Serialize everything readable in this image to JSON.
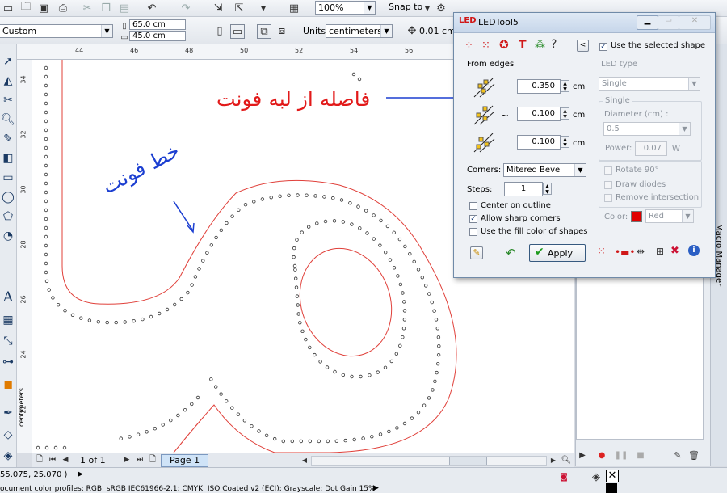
{
  "toolbar": {
    "zoom_value": "100%",
    "snap_label": "Snap to",
    "preset_value": "Custom",
    "width_value": "65.0 cm",
    "height_value": "45.0 cm",
    "units_label": "Units:",
    "units_value": "centimeters",
    "nudge_value": "0.01 cm"
  },
  "ruler": {
    "top_ticks": [
      "44",
      "46",
      "48",
      "50",
      "52",
      "54",
      "56"
    ],
    "left_ticks": [
      "34",
      "32",
      "30",
      "28",
      "26",
      "24",
      "22"
    ],
    "unit_label": "centimeters"
  },
  "annotations": {
    "red_text": "فاصله از لبه فونت",
    "blue_text": "خط فونت"
  },
  "pages": {
    "counter": "1 of 1",
    "tab": "Page 1"
  },
  "status": {
    "coords": "55.075, 25.070 )",
    "profile": "ocument color profiles: RGB: sRGB IEC61966-2.1; CMYK: ISO Coated v2 (ECI); Grayscale: Dot Gain 15%"
  },
  "docker": {
    "tabs": [
      "Macro Manager"
    ]
  },
  "dialog": {
    "title": "LEDTool5",
    "use_shape_label": "Use the selected shape",
    "use_shape_checked": true,
    "from_edges_label": "From edges",
    "edge_values": [
      "0.350",
      "0.100",
      "0.100"
    ],
    "edge_unit": "cm",
    "tilde": "~",
    "corners_label": "Corners:",
    "corners_value": "Mitered Bevel",
    "steps_label": "Steps:",
    "steps_value": "1",
    "options": [
      {
        "label": "Center on outline",
        "checked": false
      },
      {
        "label": "Allow sharp corners",
        "checked": true
      },
      {
        "label": "Use the fill color of shapes",
        "checked": false
      }
    ],
    "apply_label": "Apply",
    "led_type_label": "LED type",
    "led_type_value": "Single",
    "single_label": "Single",
    "diameter_label": "Diameter (cm) :",
    "diameter_value": "0.5",
    "power_label": "Power:",
    "power_value": "0.07",
    "power_unit": "W",
    "rotate_label": "Rotate 90°",
    "draw_diodes_label": "Draw diodes",
    "remove_intersection_label": "Remove intersection",
    "color_label": "Color:",
    "color_value": "Red",
    "color_hex": "#e00000"
  }
}
